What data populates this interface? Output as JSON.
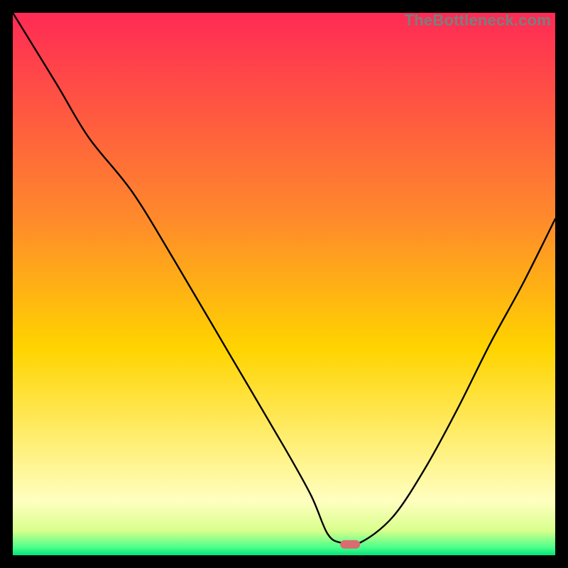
{
  "watermark": "TheBottleneck.com",
  "chart_data": {
    "type": "line",
    "title": "",
    "xlabel": "",
    "ylabel": "",
    "xlim": [
      0,
      100
    ],
    "ylim": [
      0,
      100
    ],
    "grid": false,
    "legend": false,
    "gradient_stops": [
      {
        "offset": 0.0,
        "color": "#ff2a55"
      },
      {
        "offset": 0.38,
        "color": "#ff8a2b"
      },
      {
        "offset": 0.62,
        "color": "#ffd400"
      },
      {
        "offset": 0.8,
        "color": "#fff07a"
      },
      {
        "offset": 0.9,
        "color": "#ffffc0"
      },
      {
        "offset": 0.955,
        "color": "#d8ff8c"
      },
      {
        "offset": 0.985,
        "color": "#4eff8a"
      },
      {
        "offset": 1.0,
        "color": "#00e57a"
      }
    ],
    "series": [
      {
        "name": "bottleneck-curve",
        "x": [
          0,
          8,
          14,
          22,
          30,
          40,
          50,
          55,
          58,
          60.5,
          64,
          70,
          76,
          82,
          88,
          94,
          100
        ],
        "y": [
          100,
          87,
          77,
          67,
          54,
          37,
          20,
          11,
          4,
          2.3,
          2.3,
          7,
          16,
          27,
          39,
          50,
          62
        ]
      }
    ],
    "marker": {
      "x": 62.2,
      "y": 2.0,
      "rx": 14,
      "ry": 6,
      "color": "#d86c70"
    }
  }
}
